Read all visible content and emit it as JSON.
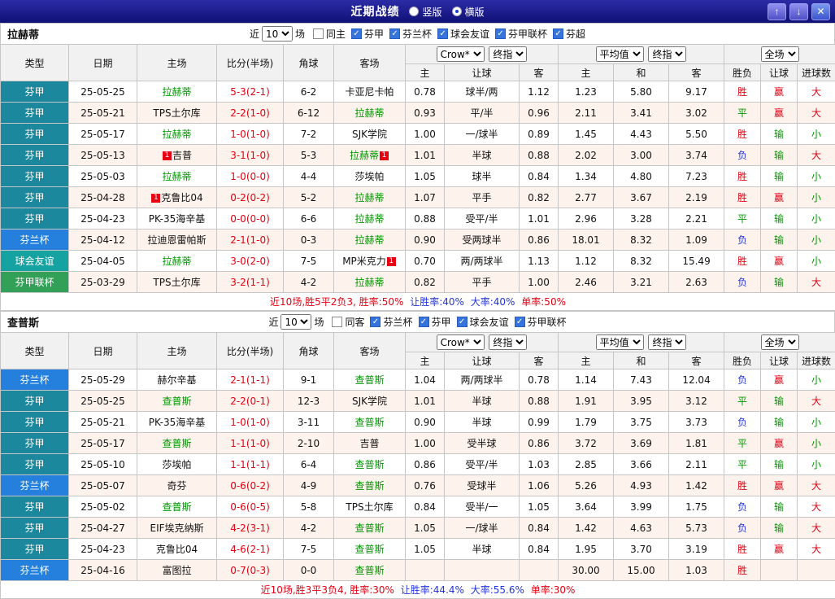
{
  "titlebar": {
    "title": "近期战绩",
    "radios": {
      "vertical": "竖版",
      "horizontal": "横版",
      "selected": "horizontal"
    }
  },
  "icons": {
    "up": "↑",
    "down": "↓",
    "close": "✕",
    "check": "✓"
  },
  "filter_labels": {
    "near": "近",
    "games": "场"
  },
  "columns": {
    "type": "类型",
    "date": "日期",
    "home": "主场",
    "score": "比分(半场)",
    "corners": "角球",
    "away": "客场",
    "odds_home": "主",
    "odds_line": "让球",
    "odds_away": "客",
    "avg_home": "主",
    "avg_draw": "和",
    "avg_away": "客",
    "result": "胜负",
    "hresult": "让球",
    "goals": "进球数"
  },
  "dropdowns": {
    "book": "Crow*",
    "final": "终指",
    "average": "平均值",
    "fulltime": "全场"
  },
  "colors": {
    "score": "#e60012",
    "focus_team": "#009900",
    "checkbox_checked": "#3674dd",
    "league": {
      "芬甲": "#1b889e",
      "芬兰杯": "#2580dd",
      "球会友谊": "#17a2a2",
      "芬甲联杯": "#33a057"
    },
    "results": {
      "胜": "#e60012",
      "平": "#009900",
      "负": "#2233dd",
      "赢": "#e60012",
      "输": "#009900",
      "大": "#e60012",
      "小": "#009900"
    }
  },
  "sections": [
    {
      "team": "拉赫蒂",
      "filter": {
        "count": "10",
        "checkboxes": [
          {
            "label": "同主",
            "checked": false
          },
          {
            "label": "芬甲",
            "checked": true
          },
          {
            "label": "芬兰杯",
            "checked": true
          },
          {
            "label": "球会友谊",
            "checked": true
          },
          {
            "label": "芬甲联杯",
            "checked": true
          },
          {
            "label": "芬超",
            "checked": true
          }
        ]
      },
      "rows": [
        {
          "league": "芬甲",
          "date": "25-05-25",
          "home": "拉赫蒂",
          "home_card": "",
          "score": "5-3(2-1)",
          "corners": "6-2",
          "away": "卡亚尼卡帕",
          "away_card": "",
          "focus": "home",
          "odds": [
            "0.78",
            "球半/两",
            "1.12"
          ],
          "avg": [
            "1.23",
            "5.80",
            "9.17"
          ],
          "results": [
            "胜",
            "赢",
            "大"
          ]
        },
        {
          "league": "芬甲",
          "date": "25-05-21",
          "home": "TPS土尔库",
          "home_card": "",
          "score": "2-2(1-0)",
          "corners": "6-12",
          "away": "拉赫蒂",
          "away_card": "",
          "focus": "away",
          "odds": [
            "0.93",
            "平/半",
            "0.96"
          ],
          "avg": [
            "2.11",
            "3.41",
            "3.02"
          ],
          "results": [
            "平",
            "赢",
            "大"
          ]
        },
        {
          "league": "芬甲",
          "date": "25-05-17",
          "home": "拉赫蒂",
          "home_card": "",
          "score": "1-0(1-0)",
          "corners": "7-2",
          "away": "SJK学院",
          "away_card": "",
          "focus": "home",
          "odds": [
            "1.00",
            "一/球半",
            "0.89"
          ],
          "avg": [
            "1.45",
            "4.43",
            "5.50"
          ],
          "results": [
            "胜",
            "输",
            "小"
          ]
        },
        {
          "league": "芬甲",
          "date": "25-05-13",
          "home": "吉普",
          "home_card": "1",
          "score": "3-1(1-0)",
          "corners": "5-3",
          "away": "拉赫蒂",
          "away_card": "1",
          "focus": "away",
          "odds": [
            "1.01",
            "半球",
            "0.88"
          ],
          "avg": [
            "2.02",
            "3.00",
            "3.74"
          ],
          "results": [
            "负",
            "输",
            "大"
          ]
        },
        {
          "league": "芬甲",
          "date": "25-05-03",
          "home": "拉赫蒂",
          "home_card": "",
          "score": "1-0(0-0)",
          "corners": "4-4",
          "away": "莎埃帕",
          "away_card": "",
          "focus": "home",
          "odds": [
            "1.05",
            "球半",
            "0.84"
          ],
          "avg": [
            "1.34",
            "4.80",
            "7.23"
          ],
          "results": [
            "胜",
            "输",
            "小"
          ]
        },
        {
          "league": "芬甲",
          "date": "25-04-28",
          "home": "克鲁比04",
          "home_card": "1",
          "score": "0-2(0-2)",
          "corners": "5-2",
          "away": "拉赫蒂",
          "away_card": "",
          "focus": "away",
          "odds": [
            "1.07",
            "平手",
            "0.82"
          ],
          "avg": [
            "2.77",
            "3.67",
            "2.19"
          ],
          "results": [
            "胜",
            "赢",
            "小"
          ]
        },
        {
          "league": "芬甲",
          "date": "25-04-23",
          "home": "PK-35海辛基",
          "home_card": "",
          "score": "0-0(0-0)",
          "corners": "6-6",
          "away": "拉赫蒂",
          "away_card": "",
          "focus": "away",
          "odds": [
            "0.88",
            "受平/半",
            "1.01"
          ],
          "avg": [
            "2.96",
            "3.28",
            "2.21"
          ],
          "results": [
            "平",
            "输",
            "小"
          ]
        },
        {
          "league": "芬兰杯",
          "date": "25-04-12",
          "home": "拉迪恩雷帕斯",
          "home_card": "",
          "score": "2-1(1-0)",
          "corners": "0-3",
          "away": "拉赫蒂",
          "away_card": "",
          "focus": "away",
          "odds": [
            "0.90",
            "受两球半",
            "0.86"
          ],
          "avg": [
            "18.01",
            "8.32",
            "1.09"
          ],
          "results": [
            "负",
            "输",
            "小"
          ]
        },
        {
          "league": "球会友谊",
          "date": "25-04-05",
          "home": "拉赫蒂",
          "home_card": "",
          "score": "3-0(2-0)",
          "corners": "7-5",
          "away": "MP米克力",
          "away_card": "1",
          "focus": "home",
          "odds": [
            "0.70",
            "两/两球半",
            "1.13"
          ],
          "avg": [
            "1.12",
            "8.32",
            "15.49"
          ],
          "results": [
            "胜",
            "赢",
            "小"
          ]
        },
        {
          "league": "芬甲联杯",
          "date": "25-03-29",
          "home": "TPS土尔库",
          "home_card": "",
          "score": "3-2(1-1)",
          "corners": "4-2",
          "away": "拉赫蒂",
          "away_card": "",
          "focus": "away",
          "odds": [
            "0.82",
            "平手",
            "1.00"
          ],
          "avg": [
            "2.46",
            "3.21",
            "2.63"
          ],
          "results": [
            "负",
            "输",
            "大"
          ]
        }
      ],
      "summary": [
        {
          "text": "近10场,胜5平2负3, 胜率:50%",
          "color": "#e60012"
        },
        {
          "text": " 让胜率:40%",
          "color": "#2233dd"
        },
        {
          "text": " 大率:40%",
          "color": "#2233dd"
        },
        {
          "text": " 单率:50%",
          "color": "#e60012"
        }
      ]
    },
    {
      "team": "查普斯",
      "filter": {
        "count": "10",
        "checkboxes": [
          {
            "label": "同客",
            "checked": false
          },
          {
            "label": "芬兰杯",
            "checked": true
          },
          {
            "label": "芬甲",
            "checked": true
          },
          {
            "label": "球会友谊",
            "checked": true
          },
          {
            "label": "芬甲联杯",
            "checked": true
          }
        ]
      },
      "rows": [
        {
          "league": "芬兰杯",
          "date": "25-05-29",
          "home": "赫尔辛基",
          "home_card": "",
          "score": "2-1(1-1)",
          "corners": "9-1",
          "away": "查普斯",
          "away_card": "",
          "focus": "away",
          "odds": [
            "1.04",
            "两/两球半",
            "0.78"
          ],
          "avg": [
            "1.14",
            "7.43",
            "12.04"
          ],
          "results": [
            "负",
            "赢",
            "小"
          ]
        },
        {
          "league": "芬甲",
          "date": "25-05-25",
          "home": "查普斯",
          "home_card": "",
          "score": "2-2(0-1)",
          "corners": "12-3",
          "away": "SJK学院",
          "away_card": "",
          "focus": "home",
          "odds": [
            "1.01",
            "半球",
            "0.88"
          ],
          "avg": [
            "1.91",
            "3.95",
            "3.12"
          ],
          "results": [
            "平",
            "输",
            "大"
          ]
        },
        {
          "league": "芬甲",
          "date": "25-05-21",
          "home": "PK-35海辛基",
          "home_card": "",
          "score": "1-0(1-0)",
          "corners": "3-11",
          "away": "查普斯",
          "away_card": "",
          "focus": "away",
          "odds": [
            "0.90",
            "半球",
            "0.99"
          ],
          "avg": [
            "1.79",
            "3.75",
            "3.73"
          ],
          "results": [
            "负",
            "输",
            "小"
          ]
        },
        {
          "league": "芬甲",
          "date": "25-05-17",
          "home": "查普斯",
          "home_card": "",
          "score": "1-1(1-0)",
          "corners": "2-10",
          "away": "吉普",
          "away_card": "",
          "focus": "home",
          "odds": [
            "1.00",
            "受半球",
            "0.86"
          ],
          "avg": [
            "3.72",
            "3.69",
            "1.81"
          ],
          "results": [
            "平",
            "赢",
            "小"
          ]
        },
        {
          "league": "芬甲",
          "date": "25-05-10",
          "home": "莎埃帕",
          "home_card": "",
          "score": "1-1(1-1)",
          "corners": "6-4",
          "away": "查普斯",
          "away_card": "",
          "focus": "away",
          "odds": [
            "0.86",
            "受平/半",
            "1.03"
          ],
          "avg": [
            "2.85",
            "3.66",
            "2.11"
          ],
          "results": [
            "平",
            "输",
            "小"
          ]
        },
        {
          "league": "芬兰杯",
          "date": "25-05-07",
          "home": "奇芬",
          "home_card": "",
          "score": "0-6(0-2)",
          "corners": "4-9",
          "away": "查普斯",
          "away_card": "",
          "focus": "away",
          "odds": [
            "0.76",
            "受球半",
            "1.06"
          ],
          "avg": [
            "5.26",
            "4.93",
            "1.42"
          ],
          "results": [
            "胜",
            "赢",
            "大"
          ]
        },
        {
          "league": "芬甲",
          "date": "25-05-02",
          "home": "查普斯",
          "home_card": "",
          "score": "0-6(0-5)",
          "corners": "5-8",
          "away": "TPS土尔库",
          "away_card": "",
          "focus": "home",
          "odds": [
            "0.84",
            "受半/一",
            "1.05"
          ],
          "avg": [
            "3.64",
            "3.99",
            "1.75"
          ],
          "results": [
            "负",
            "输",
            "大"
          ]
        },
        {
          "league": "芬甲",
          "date": "25-04-27",
          "home": "EIF埃克纳斯",
          "home_card": "",
          "score": "4-2(3-1)",
          "corners": "4-2",
          "away": "查普斯",
          "away_card": "",
          "focus": "away",
          "odds": [
            "1.05",
            "一/球半",
            "0.84"
          ],
          "avg": [
            "1.42",
            "4.63",
            "5.73"
          ],
          "results": [
            "负",
            "输",
            "大"
          ]
        },
        {
          "league": "芬甲",
          "date": "25-04-23",
          "home": "克鲁比04",
          "home_card": "",
          "score": "4-6(2-1)",
          "corners": "7-5",
          "away": "查普斯",
          "away_card": "",
          "focus": "away",
          "odds": [
            "1.05",
            "半球",
            "0.84"
          ],
          "avg": [
            "1.95",
            "3.70",
            "3.19"
          ],
          "results": [
            "胜",
            "赢",
            "大"
          ]
        },
        {
          "league": "芬兰杯",
          "date": "25-04-16",
          "home": "富图拉",
          "home_card": "",
          "score": "0-7(0-3)",
          "corners": "0-0",
          "away": "查普斯",
          "away_card": "",
          "focus": "away",
          "odds": [
            "",
            "",
            ""
          ],
          "avg": [
            "30.00",
            "15.00",
            "1.03"
          ],
          "results": [
            "胜",
            "",
            ""
          ]
        }
      ],
      "summary": [
        {
          "text": "近10场,胜3平3负4, 胜率:30%",
          "color": "#e60012"
        },
        {
          "text": " 让胜率:44.4%",
          "color": "#2233dd"
        },
        {
          "text": " 大率:55.6%",
          "color": "#2233dd"
        },
        {
          "text": " 单率:30%",
          "color": "#e60012"
        }
      ]
    }
  ]
}
